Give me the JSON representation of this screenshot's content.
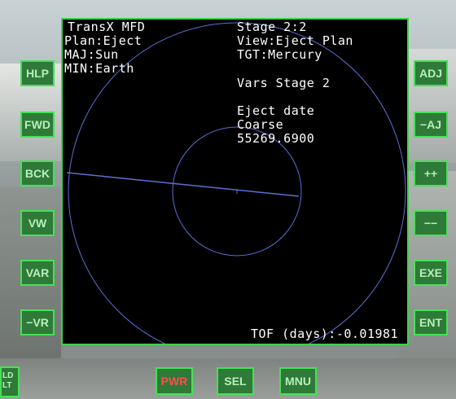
{
  "mfd": {
    "left_lines": [
      "TransX MFD",
      "Plan:Eject",
      "MAJ:Sun",
      "MIN:Earth"
    ],
    "right_lines": [
      "Stage 2:2",
      "View:Eject Plan",
      "TGT:Mercury"
    ],
    "vars_title": "Vars Stage 2",
    "var_lines": [
      "Eject date",
      "Coarse",
      "55269.6900"
    ],
    "tof": "TOF (days):-0.01981",
    "line_color": "#5b6fd6"
  },
  "left_buttons": [
    "HLP",
    "FWD",
    "BCK",
    "VW",
    "VAR",
    "−VR"
  ],
  "right_buttons": [
    "ADJ",
    "−AJ",
    "++",
    "−−",
    "EXE",
    "ENT"
  ],
  "bottom_buttons": [
    "PWR",
    "SEL",
    "MNU"
  ],
  "corner_label": "LD\nLT",
  "colors": {
    "bezel_green": "#47e058",
    "button_fill": "#2f7a38",
    "power_red": "#ff4d4d"
  }
}
